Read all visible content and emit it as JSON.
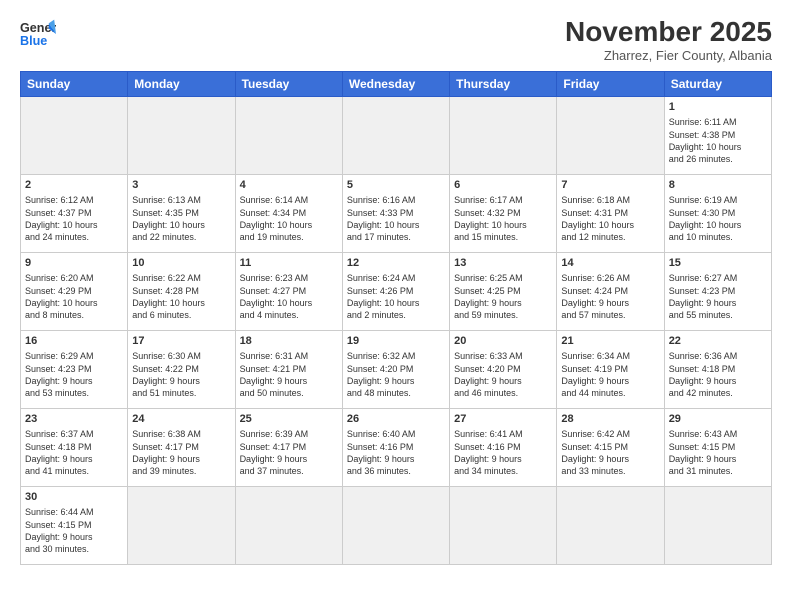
{
  "header": {
    "logo_general": "General",
    "logo_blue": "Blue",
    "month_title": "November 2025",
    "subtitle": "Zharrez, Fier County, Albania"
  },
  "days_of_week": [
    "Sunday",
    "Monday",
    "Tuesday",
    "Wednesday",
    "Thursday",
    "Friday",
    "Saturday"
  ],
  "weeks": [
    [
      {
        "day": "",
        "info": "",
        "gray": true
      },
      {
        "day": "",
        "info": "",
        "gray": true
      },
      {
        "day": "",
        "info": "",
        "gray": true
      },
      {
        "day": "",
        "info": "",
        "gray": true
      },
      {
        "day": "",
        "info": "",
        "gray": true
      },
      {
        "day": "",
        "info": "",
        "gray": true
      },
      {
        "day": "1",
        "info": "Sunrise: 6:11 AM\nSunset: 4:38 PM\nDaylight: 10 hours\nand 26 minutes."
      }
    ],
    [
      {
        "day": "2",
        "info": "Sunrise: 6:12 AM\nSunset: 4:37 PM\nDaylight: 10 hours\nand 24 minutes."
      },
      {
        "day": "3",
        "info": "Sunrise: 6:13 AM\nSunset: 4:35 PM\nDaylight: 10 hours\nand 22 minutes."
      },
      {
        "day": "4",
        "info": "Sunrise: 6:14 AM\nSunset: 4:34 PM\nDaylight: 10 hours\nand 19 minutes."
      },
      {
        "day": "5",
        "info": "Sunrise: 6:16 AM\nSunset: 4:33 PM\nDaylight: 10 hours\nand 17 minutes."
      },
      {
        "day": "6",
        "info": "Sunrise: 6:17 AM\nSunset: 4:32 PM\nDaylight: 10 hours\nand 15 minutes."
      },
      {
        "day": "7",
        "info": "Sunrise: 6:18 AM\nSunset: 4:31 PM\nDaylight: 10 hours\nand 12 minutes."
      },
      {
        "day": "8",
        "info": "Sunrise: 6:19 AM\nSunset: 4:30 PM\nDaylight: 10 hours\nand 10 minutes."
      }
    ],
    [
      {
        "day": "9",
        "info": "Sunrise: 6:20 AM\nSunset: 4:29 PM\nDaylight: 10 hours\nand 8 minutes."
      },
      {
        "day": "10",
        "info": "Sunrise: 6:22 AM\nSunset: 4:28 PM\nDaylight: 10 hours\nand 6 minutes."
      },
      {
        "day": "11",
        "info": "Sunrise: 6:23 AM\nSunset: 4:27 PM\nDaylight: 10 hours\nand 4 minutes."
      },
      {
        "day": "12",
        "info": "Sunrise: 6:24 AM\nSunset: 4:26 PM\nDaylight: 10 hours\nand 2 minutes."
      },
      {
        "day": "13",
        "info": "Sunrise: 6:25 AM\nSunset: 4:25 PM\nDaylight: 9 hours\nand 59 minutes."
      },
      {
        "day": "14",
        "info": "Sunrise: 6:26 AM\nSunset: 4:24 PM\nDaylight: 9 hours\nand 57 minutes."
      },
      {
        "day": "15",
        "info": "Sunrise: 6:27 AM\nSunset: 4:23 PM\nDaylight: 9 hours\nand 55 minutes."
      }
    ],
    [
      {
        "day": "16",
        "info": "Sunrise: 6:29 AM\nSunset: 4:23 PM\nDaylight: 9 hours\nand 53 minutes."
      },
      {
        "day": "17",
        "info": "Sunrise: 6:30 AM\nSunset: 4:22 PM\nDaylight: 9 hours\nand 51 minutes."
      },
      {
        "day": "18",
        "info": "Sunrise: 6:31 AM\nSunset: 4:21 PM\nDaylight: 9 hours\nand 50 minutes."
      },
      {
        "day": "19",
        "info": "Sunrise: 6:32 AM\nSunset: 4:20 PM\nDaylight: 9 hours\nand 48 minutes."
      },
      {
        "day": "20",
        "info": "Sunrise: 6:33 AM\nSunset: 4:20 PM\nDaylight: 9 hours\nand 46 minutes."
      },
      {
        "day": "21",
        "info": "Sunrise: 6:34 AM\nSunset: 4:19 PM\nDaylight: 9 hours\nand 44 minutes."
      },
      {
        "day": "22",
        "info": "Sunrise: 6:36 AM\nSunset: 4:18 PM\nDaylight: 9 hours\nand 42 minutes."
      }
    ],
    [
      {
        "day": "23",
        "info": "Sunrise: 6:37 AM\nSunset: 4:18 PM\nDaylight: 9 hours\nand 41 minutes."
      },
      {
        "day": "24",
        "info": "Sunrise: 6:38 AM\nSunset: 4:17 PM\nDaylight: 9 hours\nand 39 minutes."
      },
      {
        "day": "25",
        "info": "Sunrise: 6:39 AM\nSunset: 4:17 PM\nDaylight: 9 hours\nand 37 minutes."
      },
      {
        "day": "26",
        "info": "Sunrise: 6:40 AM\nSunset: 4:16 PM\nDaylight: 9 hours\nand 36 minutes."
      },
      {
        "day": "27",
        "info": "Sunrise: 6:41 AM\nSunset: 4:16 PM\nDaylight: 9 hours\nand 34 minutes."
      },
      {
        "day": "28",
        "info": "Sunrise: 6:42 AM\nSunset: 4:15 PM\nDaylight: 9 hours\nand 33 minutes."
      },
      {
        "day": "29",
        "info": "Sunrise: 6:43 AM\nSunset: 4:15 PM\nDaylight: 9 hours\nand 31 minutes."
      }
    ],
    [
      {
        "day": "30",
        "info": "Sunrise: 6:44 AM\nSunset: 4:15 PM\nDaylight: 9 hours\nand 30 minutes."
      },
      {
        "day": "",
        "info": "",
        "gray": true
      },
      {
        "day": "",
        "info": "",
        "gray": true
      },
      {
        "day": "",
        "info": "",
        "gray": true
      },
      {
        "day": "",
        "info": "",
        "gray": true
      },
      {
        "day": "",
        "info": "",
        "gray": true
      },
      {
        "day": "",
        "info": "",
        "gray": true
      }
    ]
  ]
}
